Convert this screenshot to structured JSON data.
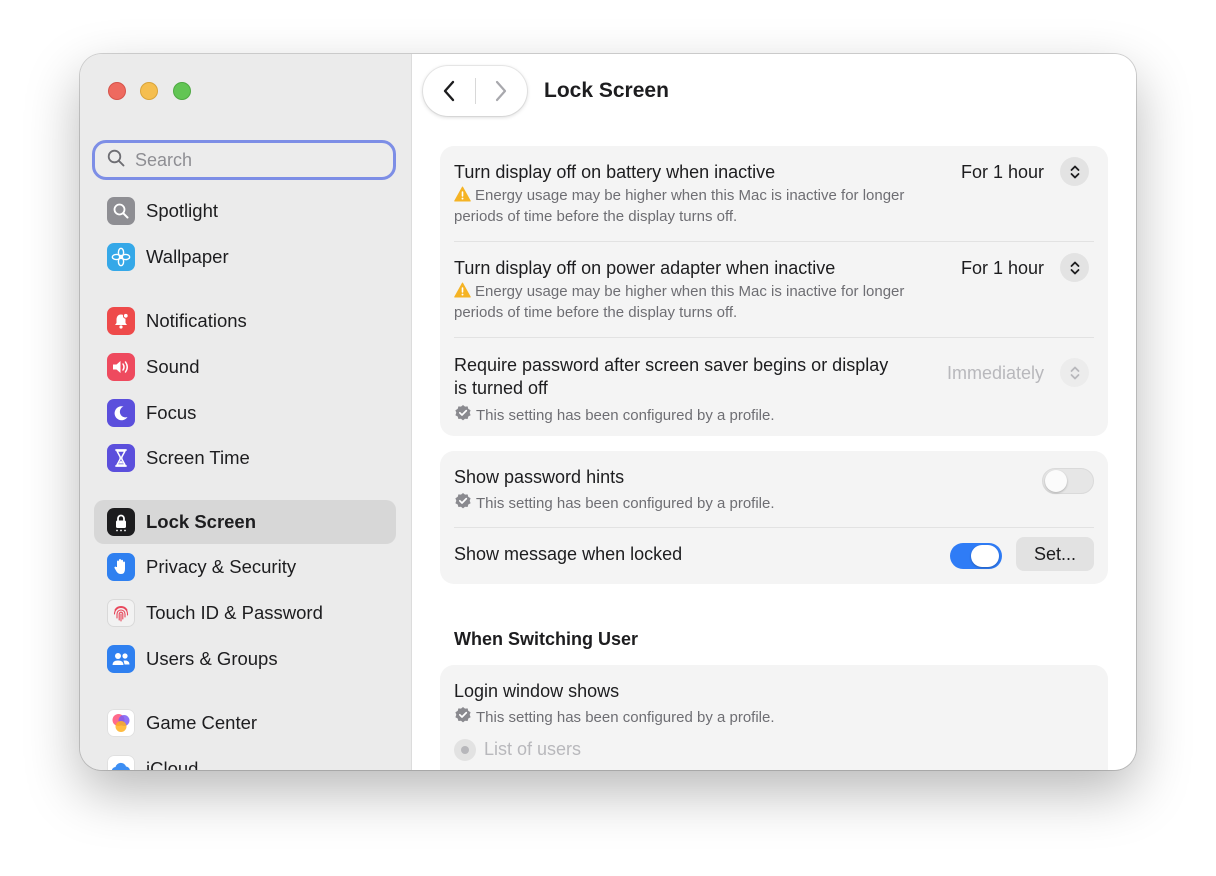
{
  "sidebar": {
    "search": {
      "placeholder": "Search",
      "value": ""
    },
    "items": [
      {
        "label": "Spotlight",
        "icon": "spotlight-icon",
        "color": "#8e8e93"
      },
      {
        "label": "Wallpaper",
        "icon": "wallpaper-icon",
        "color": "#35a8e8"
      },
      {
        "label": "Notifications",
        "icon": "notifications-icon",
        "color": "#ee4a4a"
      },
      {
        "label": "Sound",
        "icon": "sound-icon",
        "color": "#ee4a5e"
      },
      {
        "label": "Focus",
        "icon": "focus-icon",
        "color": "#5b4fdc"
      },
      {
        "label": "Screen Time",
        "icon": "screen-time-icon",
        "color": "#5b4fdc"
      },
      {
        "label": "Lock Screen",
        "icon": "lock-screen-icon",
        "color": "#1c1c1e",
        "selected": true
      },
      {
        "label": "Privacy & Security",
        "icon": "privacy-hand-icon",
        "color": "#2f80f0"
      },
      {
        "label": "Touch ID & Password",
        "icon": "fingerprint-icon",
        "color": "#f2f2f2"
      },
      {
        "label": "Users & Groups",
        "icon": "users-icon",
        "color": "#2f80f0"
      },
      {
        "label": "Game Center",
        "icon": "game-center-icon",
        "color": "#f5a623"
      },
      {
        "label": "iCloud",
        "icon": "icloud-icon",
        "color": "#2f80f0"
      }
    ]
  },
  "header": {
    "title": "Lock Screen"
  },
  "settings": {
    "display_battery": {
      "title": "Turn display off on battery when inactive",
      "value": "For 1 hour",
      "note": "Energy usage may be higher when this Mac is inactive for longer periods of time before the display turns off."
    },
    "display_power": {
      "title": "Turn display off on power adapter when inactive",
      "value": "For 1 hour",
      "note": "Energy usage may be higher when this Mac is inactive for longer periods of time before the display turns off."
    },
    "require_password": {
      "title": "Require password after screen saver begins or display is turned off",
      "value": "Immediately",
      "note": "This setting has been configured by a profile."
    },
    "password_hints": {
      "title": "Show password hints",
      "note": "This setting has been configured by a profile.",
      "enabled": false
    },
    "message_locked": {
      "title": "Show message when locked",
      "enabled": true,
      "button": "Set..."
    }
  },
  "switching": {
    "heading": "When Switching User",
    "login_window": {
      "title": "Login window shows",
      "note": "This setting has been configured by a profile.",
      "option": "List of users"
    }
  },
  "colors": {
    "accent": "#2f7cf6",
    "warning": "#f5b324",
    "search_focus": "#7d8ee6"
  }
}
